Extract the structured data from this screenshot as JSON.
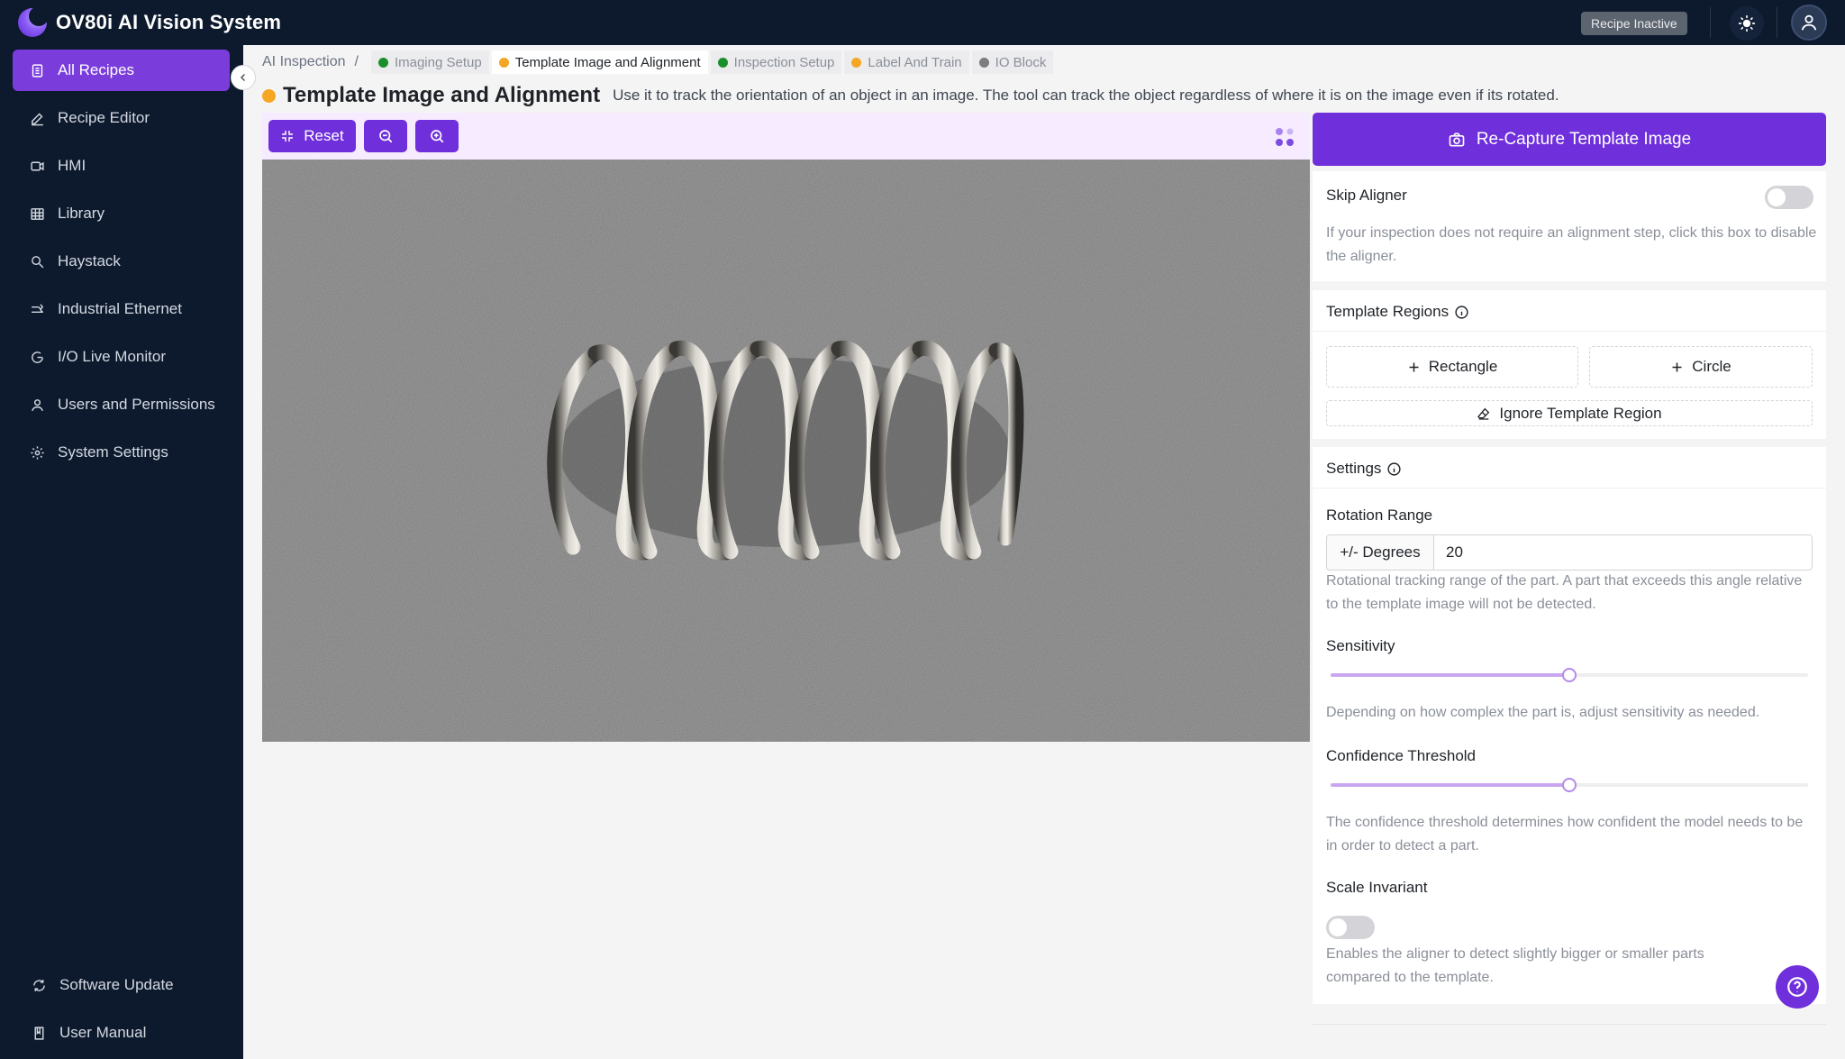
{
  "app": {
    "title": "OV80i AI Vision System",
    "recipe_status": "Recipe Inactive"
  },
  "sidebar": {
    "items": [
      {
        "label": "All Recipes",
        "icon": "document-list-icon",
        "active": true
      },
      {
        "label": "Recipe Editor",
        "icon": "pencil-icon"
      },
      {
        "label": "HMI",
        "icon": "video-icon"
      },
      {
        "label": "Library",
        "icon": "table-icon"
      },
      {
        "label": "Haystack",
        "icon": "search-icon"
      },
      {
        "label": "Industrial Ethernet",
        "icon": "network-icon"
      },
      {
        "label": "I/O Live Monitor",
        "icon": "gauge-icon"
      },
      {
        "label": "Users and Permissions",
        "icon": "user-icon"
      },
      {
        "label": "System Settings",
        "icon": "gear-icon"
      }
    ],
    "footer": [
      {
        "label": "Software Update",
        "icon": "refresh-icon"
      },
      {
        "label": "User Manual",
        "icon": "book-icon"
      }
    ]
  },
  "breadcrumb": {
    "root": "AI Inspection",
    "separator": "/",
    "steps": [
      {
        "label": "Imaging Setup",
        "color": "#1a8f2a"
      },
      {
        "label": "Template Image and Alignment",
        "color": "#f5a623",
        "current": true
      },
      {
        "label": "Inspection Setup",
        "color": "#1a8f2a"
      },
      {
        "label": "Label And Train",
        "color": "#f5a623"
      },
      {
        "label": "IO Block",
        "color": "#7c7c7c"
      }
    ]
  },
  "page": {
    "title": "Template Image and Alignment",
    "description": "Use it to track the orientation of an object in an image. The tool can track the object regardless of where it is on the image even if its rotated.",
    "status_color": "#f5a623"
  },
  "viewer": {
    "reset_label": "Reset"
  },
  "panel": {
    "recapture_label": "Re-Capture Template Image",
    "skip_aligner": {
      "label": "Skip Aligner",
      "enabled": false,
      "help": "If your inspection does not require an alignment step, click this box to disable the aligner."
    },
    "template_regions": {
      "title": "Template Regions",
      "rectangle_label": "Rectangle",
      "circle_label": "Circle",
      "ignore_label": "Ignore Template Region"
    },
    "settings": {
      "title": "Settings",
      "rotation": {
        "label": "Rotation Range",
        "addon": "+/- Degrees",
        "value": "20",
        "help": "Rotational tracking range of the part. A part that exceeds this angle relative to the template image will not be detected."
      },
      "sensitivity": {
        "label": "Sensitivity",
        "value_fraction": 0.5,
        "help": "Depending on how complex the part is, adjust sensitivity as needed."
      },
      "confidence": {
        "label": "Confidence Threshold",
        "value_fraction": 0.5,
        "help": "The confidence threshold determines how confident the model needs to be in order to detect a part."
      },
      "scale_invariant": {
        "label": "Scale Invariant",
        "enabled": false,
        "help": "Enables the aligner to detect slightly bigger or smaller parts compared to the template."
      }
    }
  },
  "colors": {
    "accent": "#6f2fdb",
    "sidebar_bg": "#0d1a2e",
    "active_nav": "#7a3ddb"
  }
}
